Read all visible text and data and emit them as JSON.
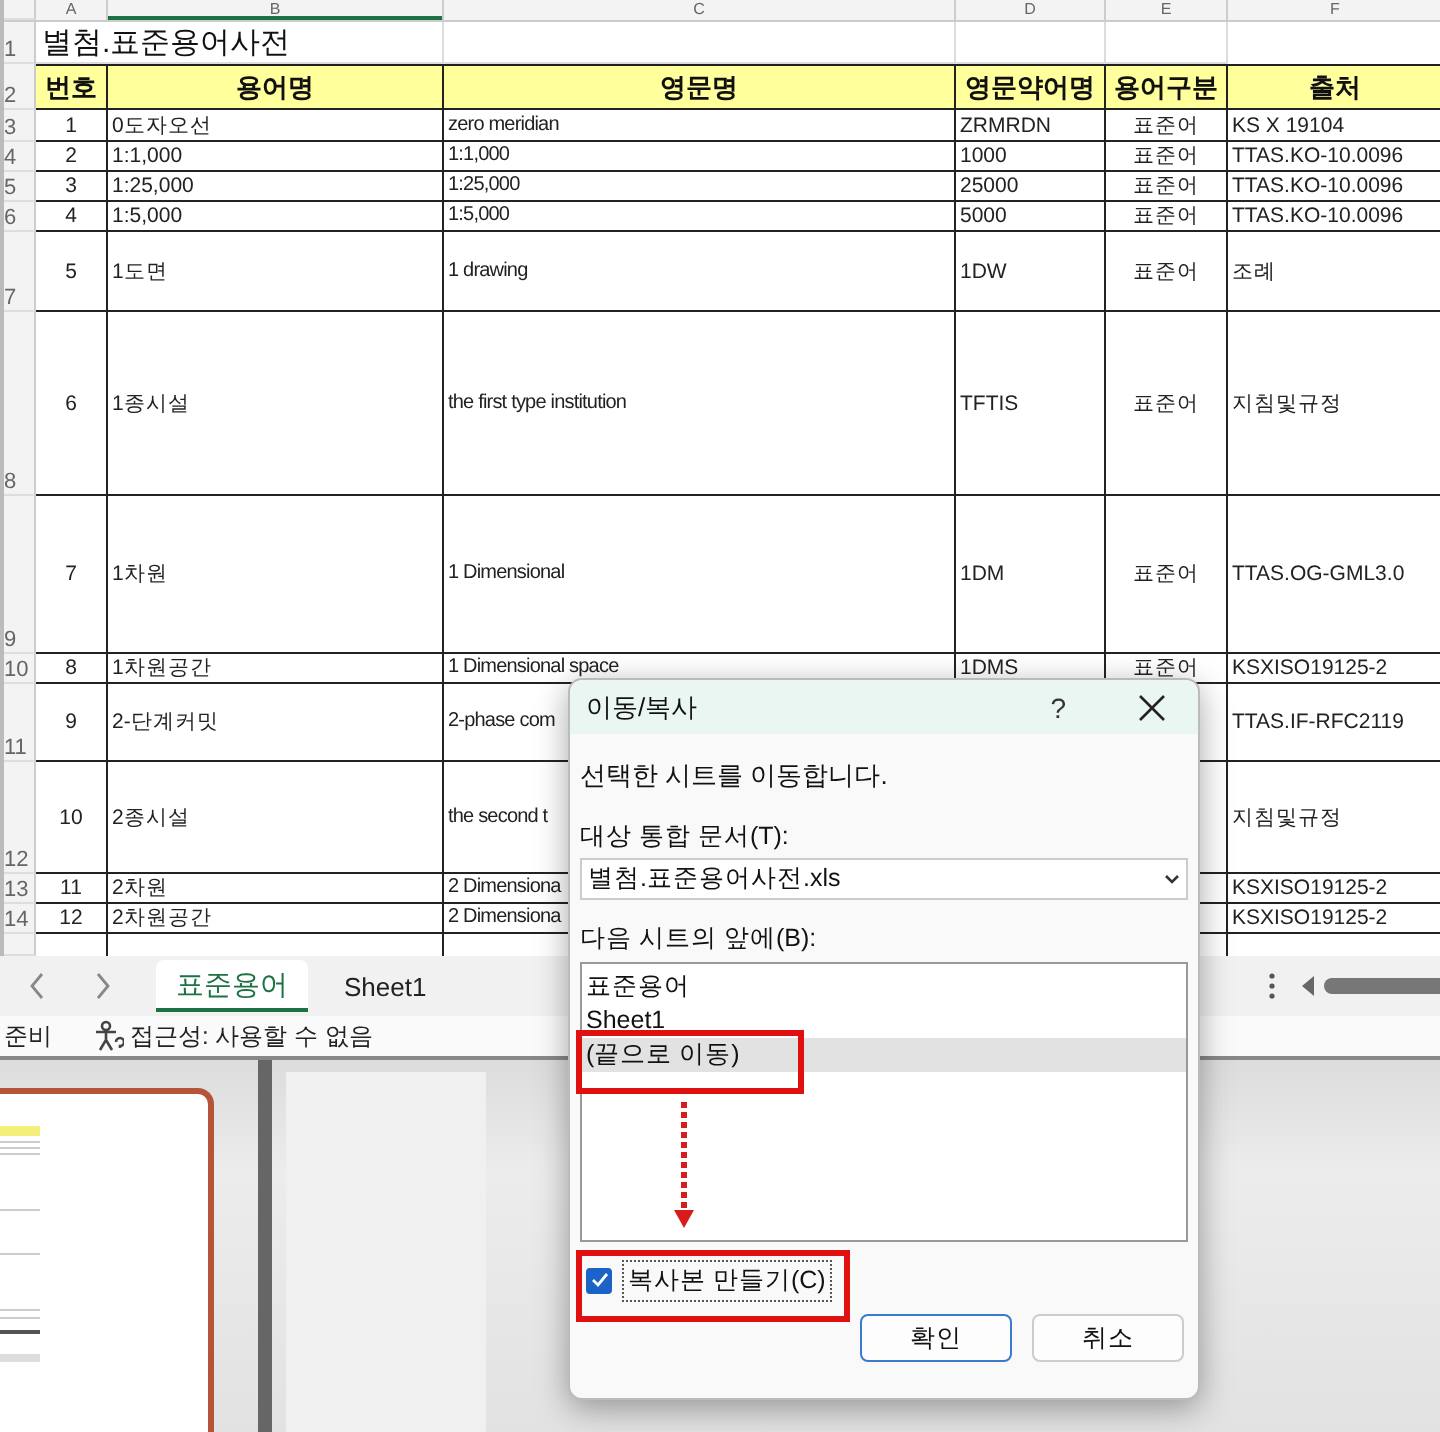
{
  "column_headers": [
    "A",
    "B",
    "C",
    "D",
    "E",
    "F"
  ],
  "sheet_title": {
    "row_number": "1",
    "text": "별첨.표준용어사전"
  },
  "table": {
    "row_number": "2",
    "columns": [
      "번호",
      "용어명",
      "영문명",
      "영문약어명",
      "용어구분",
      "출처"
    ],
    "rows": [
      {
        "row_number": "3",
        "cells": [
          "1",
          "0도자오선",
          "zero meridian",
          "ZRMRDN",
          "표준어",
          "KS X 19104"
        ]
      },
      {
        "row_number": "4",
        "cells": [
          "2",
          "1:1,000",
          "1:1,000",
          "1000",
          "표준어",
          "TTAS.KO-10.0096"
        ]
      },
      {
        "row_number": "5",
        "cells": [
          "3",
          "1:25,000",
          "1:25,000",
          "25000",
          "표준어",
          "TTAS.KO-10.0096"
        ]
      },
      {
        "row_number": "6",
        "cells": [
          "4",
          "1:5,000",
          "1:5,000",
          "5000",
          "표준어",
          "TTAS.KO-10.0096"
        ]
      },
      {
        "row_number": "7",
        "cells": [
          "5",
          "1도면",
          "1 drawing",
          "1DW",
          "표준어",
          "조례"
        ]
      },
      {
        "row_number": "8",
        "cells": [
          "6",
          "1종시설",
          "the first type institution",
          "TFTIS",
          "표준어",
          "지침및규정"
        ]
      },
      {
        "row_number": "9",
        "cells": [
          "7",
          "1차원",
          "1 Dimensional",
          "1DM",
          "표준어",
          "TTAS.OG-GML3.0"
        ]
      },
      {
        "row_number": "10",
        "cells": [
          "8",
          "1차원공간",
          "1 Dimensional space",
          "1DMS",
          "표준어",
          "KSXISO19125-2"
        ]
      },
      {
        "row_number": "11",
        "cells": [
          "9",
          "2-단계커밋",
          "2-phase com",
          null,
          null,
          "TTAS.IF-RFC2119"
        ]
      },
      {
        "row_number": "12",
        "cells": [
          "10",
          "2종시설",
          "the second t",
          null,
          null,
          "지침및규정"
        ]
      },
      {
        "row_number": "13",
        "cells": [
          "11",
          "2차원",
          "2 Dimensiona",
          null,
          null,
          "KSXISO19125-2"
        ]
      },
      {
        "row_number": "14",
        "cells": [
          "12",
          "2차원공간",
          "2 Dimensiona",
          null,
          null,
          "KSXISO19125-2"
        ]
      }
    ]
  },
  "sheet_tabs": [
    {
      "label": "표준용어",
      "selected": true
    },
    {
      "label": "Sheet1",
      "selected": false
    }
  ],
  "status_bar": {
    "ready": "준비",
    "accessibility": "접근성: 사용할 수 없음"
  },
  "dialog": {
    "title": "이동/복사",
    "help": "?",
    "description": "선택한 시트를 이동합니다.",
    "workbook_label": "대상 통합 문서(T):",
    "workbook_value": "별첨.표준용어사전.xls",
    "before_sheet_label": "다음 시트의 앞에(B):",
    "sheets": [
      {
        "label": "표준용어",
        "selected": false
      },
      {
        "label": "Sheet1",
        "selected": false
      },
      {
        "label": "(끝으로 이동)",
        "selected": true
      }
    ],
    "copy_checkbox": {
      "label": "복사본 만들기(C)",
      "checked": true
    },
    "buttons": [
      {
        "label": "확인",
        "default": true
      },
      {
        "label": "취소",
        "default": false
      }
    ]
  }
}
